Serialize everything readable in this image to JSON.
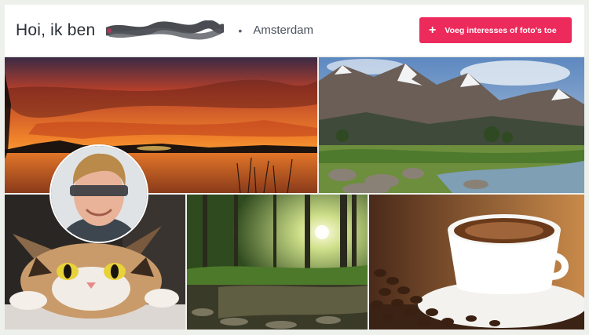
{
  "header": {
    "greeting": "Hoi, ik ben",
    "separator": "•",
    "city": "Amsterdam",
    "add_button": {
      "icon": "plus-icon",
      "label": "Voeg interesses of foto's toe"
    }
  },
  "colors": {
    "accent": "#ec2a5b",
    "header_bg": "#ffffff",
    "page_bg": "#eef0ec",
    "title_text": "#2a2f36"
  },
  "photos": [
    {
      "subject": "sunset-lake"
    },
    {
      "subject": "mountain-landscape"
    },
    {
      "subject": "cat"
    },
    {
      "subject": "forest-stream"
    },
    {
      "subject": "coffee-cup"
    }
  ],
  "profile": {
    "avatar": "user-avatar",
    "name_redacted": true
  }
}
